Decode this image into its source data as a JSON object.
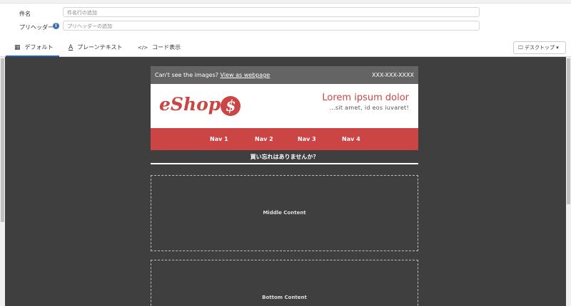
{
  "form": {
    "subject_label": "件名",
    "subject_placeholder": "件名行の追加",
    "preheader_label": "プリヘッダー",
    "preheader_placeholder": "プリヘッダーの追加",
    "info_glyph": "i"
  },
  "tabs": [
    {
      "icon": "layout-icon",
      "glyph": "▦",
      "label": "デフォルト",
      "active": true
    },
    {
      "icon": "text-icon",
      "glyph": "A",
      "label": "プレーンテキスト",
      "active": false
    },
    {
      "icon": "code-icon",
      "glyph": "</>",
      "label": "コード表示",
      "active": false
    }
  ],
  "device": {
    "icon": "monitor-icon",
    "glyph": "🖵",
    "label": "デスクトップ",
    "caret": "▾"
  },
  "email": {
    "preheader_text": "Can't see the images?",
    "preheader_link": "View as webpage",
    "phone": "XXX-XXX-XXXX",
    "logo_text": "eShop",
    "logo_symbol": "$",
    "headline": "Lorem ipsum dolor",
    "subline": "...sit amet, id eos iuvaret!",
    "nav": [
      "Nav 1",
      "Nav 2",
      "Nav 3",
      "Nav 4"
    ],
    "promo": "買い忘れはありませんか？",
    "middle": "Middle Content",
    "bottom": "Bottom Content"
  },
  "colors": {
    "brand": "#ca4544",
    "canvas": "#3f3f40",
    "accent": "#2a5fa8"
  }
}
